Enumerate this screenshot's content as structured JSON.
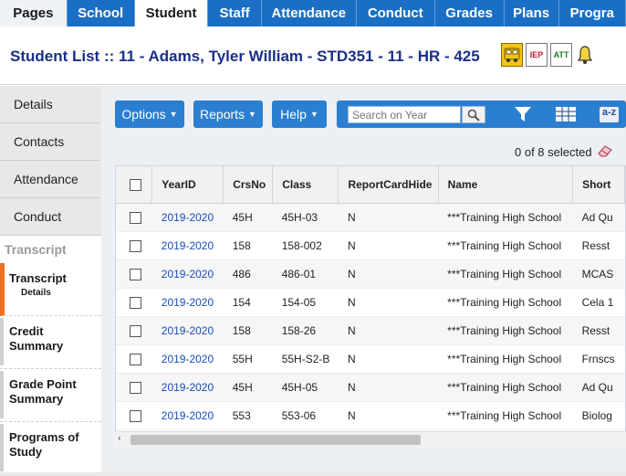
{
  "topnav": {
    "tabs": [
      "Pages",
      "School",
      "Student",
      "Staff",
      "Attendance",
      "Conduct",
      "Grades",
      "Plans",
      "Progra"
    ]
  },
  "header": {
    "title_prefix": "Student List",
    "separator": " :: ",
    "title_student": "11 - Adams, Tyler William - STD351 - 11 - HR - 425",
    "icons": [
      "bus-icon",
      "iep-icon",
      "att-icon",
      "bell-icon"
    ],
    "iep_label": "IEP",
    "att_label": "ATT"
  },
  "sidebar": {
    "items": [
      "Details",
      "Contacts",
      "Attendance",
      "Conduct"
    ],
    "section": "Transcript",
    "links": [
      {
        "label": "Transcript",
        "sub": "Details"
      },
      {
        "label": "Credit Summary"
      },
      {
        "label": "Grade Point Summary"
      },
      {
        "label": "Programs of Study"
      }
    ]
  },
  "toolbar": {
    "options": "Options",
    "reports": "Reports",
    "help": "Help",
    "search_placeholder": "Search on Year",
    "az_label": "a-z"
  },
  "selection": "0 of 8 selected",
  "table": {
    "columns": [
      "YearID",
      "CrsNo",
      "Class",
      "ReportCardHide",
      "Name",
      "Short"
    ],
    "rows": [
      [
        "2019-2020",
        "45H",
        "45H-03",
        "N",
        "***Training High School",
        "Ad Qu"
      ],
      [
        "2019-2020",
        "158",
        "158-002",
        "N",
        "***Training High School",
        "Resst"
      ],
      [
        "2019-2020",
        "486",
        "486-01",
        "N",
        "***Training High School",
        "MCAS"
      ],
      [
        "2019-2020",
        "154",
        "154-05",
        "N",
        "***Training High School",
        "Cela 1"
      ],
      [
        "2019-2020",
        "158",
        "158-26",
        "N",
        "***Training High School",
        "Resst"
      ],
      [
        "2019-2020",
        "55H",
        "55H-S2-B",
        "N",
        "***Training High School",
        "Frnscs"
      ],
      [
        "2019-2020",
        "45H",
        "45H-05",
        "N",
        "***Training High School",
        "Ad Qu"
      ],
      [
        "2019-2020",
        "553",
        "553-06",
        "N",
        "***Training High School",
        "Biolog"
      ]
    ]
  },
  "colors": {
    "nav_blue": "#1a6fc4",
    "button_blue": "#2b7fd1",
    "title_navy": "#1a2f8a",
    "active_marker": "#f07020",
    "link_blue": "#1a4db3"
  }
}
